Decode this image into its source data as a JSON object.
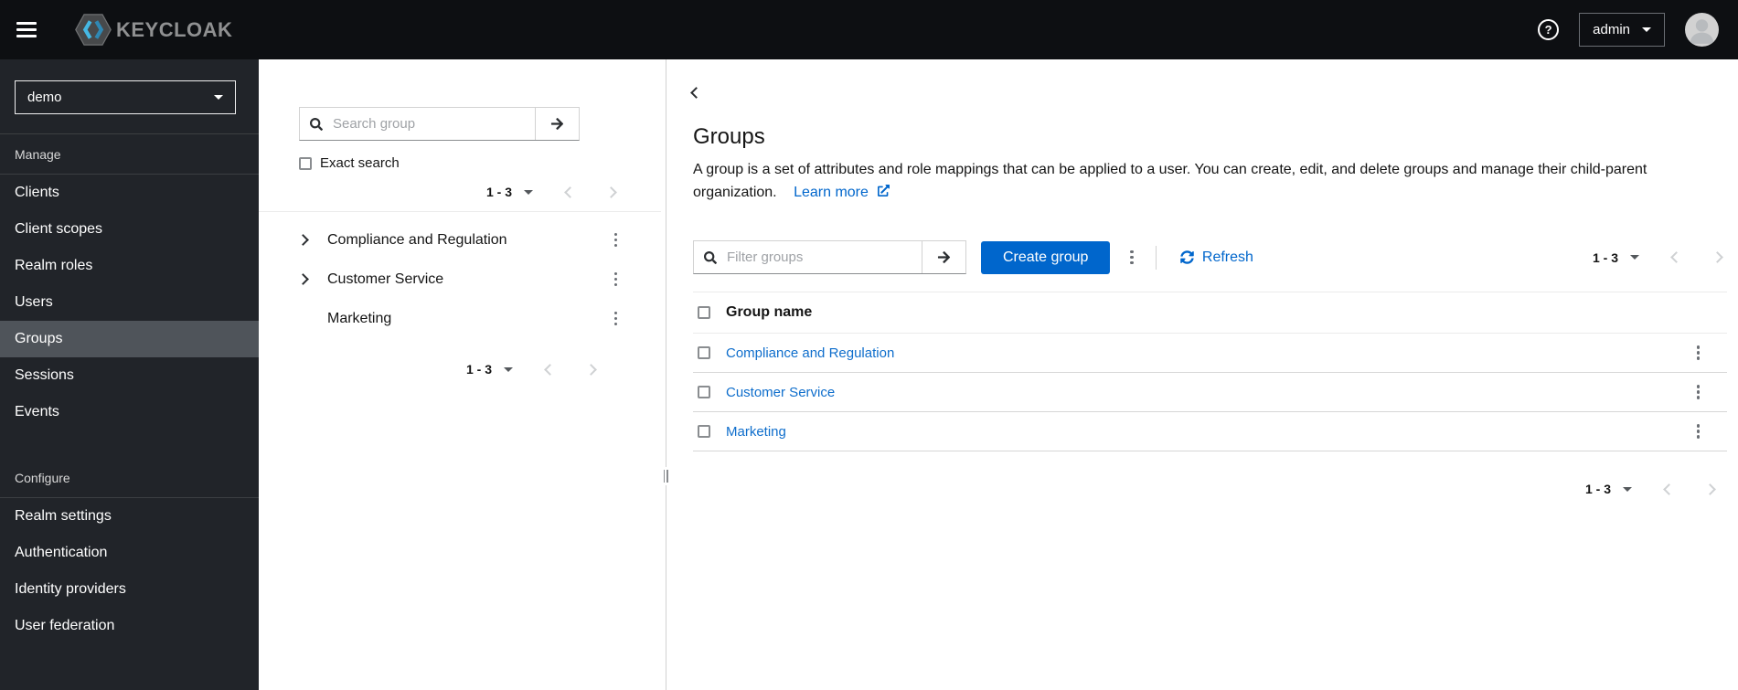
{
  "header": {
    "brand": "KEYCLOAK",
    "user_menu_label": "admin"
  },
  "sidebar": {
    "realm_selector_value": "demo",
    "sections": [
      {
        "label": "Manage",
        "items": [
          {
            "label": "Clients"
          },
          {
            "label": "Client scopes"
          },
          {
            "label": "Realm roles"
          },
          {
            "label": "Users"
          },
          {
            "label": "Groups",
            "active": true
          },
          {
            "label": "Sessions"
          },
          {
            "label": "Events"
          }
        ]
      },
      {
        "label": "Configure",
        "items": [
          {
            "label": "Realm settings"
          },
          {
            "label": "Authentication"
          },
          {
            "label": "Identity providers"
          },
          {
            "label": "User federation"
          }
        ]
      }
    ]
  },
  "tree_panel": {
    "search_placeholder": "Search group",
    "exact_search_label": "Exact search",
    "pagination_top": {
      "range": "1 - 3"
    },
    "groups": [
      {
        "name": "Compliance and Regulation",
        "expandable": true
      },
      {
        "name": "Customer Service",
        "expandable": true
      },
      {
        "name": "Marketing",
        "expandable": false
      }
    ],
    "pagination_bottom": {
      "range": "1 - 3"
    }
  },
  "main": {
    "title": "Groups",
    "description": "A group is a set of attributes and role mappings that can be applied to a user. You can create, edit, and delete groups and manage their child-parent organization.",
    "learn_more_label": "Learn more",
    "toolbar": {
      "filter_placeholder": "Filter groups",
      "create_button_label": "Create group",
      "refresh_label": "Refresh",
      "pagination": {
        "range": "1 - 3"
      }
    },
    "table": {
      "column_header": "Group name",
      "rows": [
        {
          "name": "Compliance and Regulation"
        },
        {
          "name": "Customer Service"
        },
        {
          "name": "Marketing"
        }
      ]
    },
    "pagination_bottom": {
      "range": "1 - 3"
    }
  },
  "colors": {
    "accent_blue": "#0066cc",
    "topbar_bg": "#0d0f12",
    "sidebar_bg": "#212429",
    "sidebar_active_bg": "#4f545a"
  }
}
